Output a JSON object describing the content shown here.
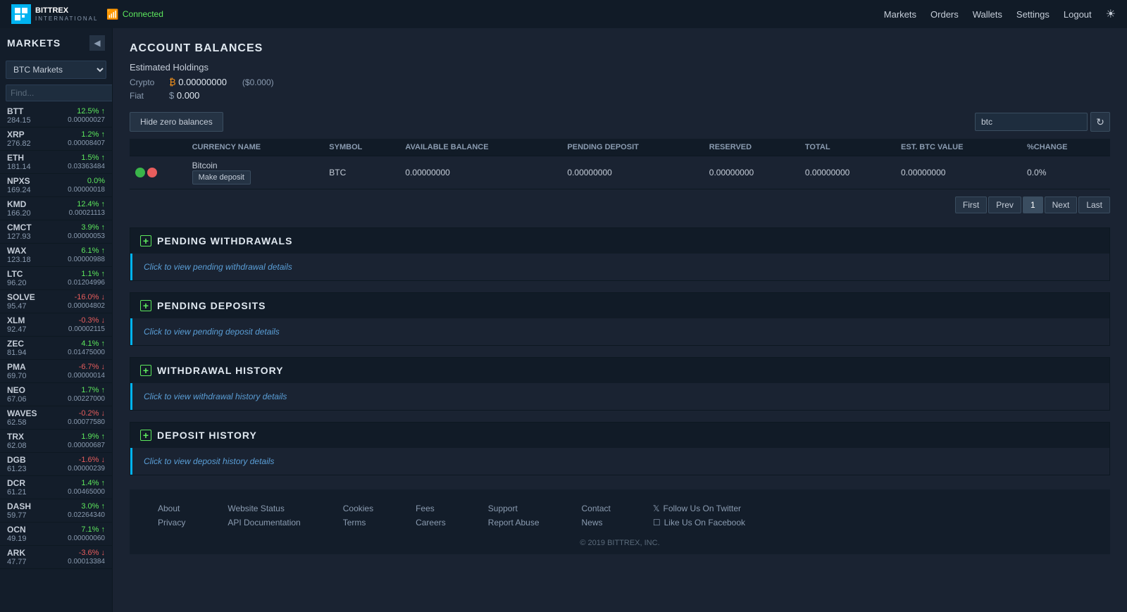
{
  "topNav": {
    "logoText": "BITTREX",
    "logoSub": "INTERNATIONAL",
    "connected": "Connected",
    "links": [
      "Markets",
      "Orders",
      "Wallets",
      "Settings",
      "Logout"
    ]
  },
  "sidebar": {
    "title": "MARKETS",
    "marketSelect": "BTC Markets",
    "searchPlaceholder": "Find...",
    "markets": [
      {
        "name": "BTT",
        "change": "12.5%",
        "dir": "up",
        "price": "284.15",
        "btc": "0.00000027"
      },
      {
        "name": "XRP",
        "change": "1.2%",
        "dir": "up",
        "price": "276.82",
        "btc": "0.00008407"
      },
      {
        "name": "ETH",
        "change": "1.5%",
        "dir": "up",
        "price": "181.14",
        "btc": "0.03363484"
      },
      {
        "name": "NPXS",
        "change": "0.0%",
        "dir": "neutral",
        "price": "169.24",
        "btc": "0.00000018"
      },
      {
        "name": "KMD",
        "change": "12.4%",
        "dir": "up",
        "price": "166.20",
        "btc": "0.00021113"
      },
      {
        "name": "CMCT",
        "change": "3.9%",
        "dir": "up",
        "price": "127.93",
        "btc": "0.00000053"
      },
      {
        "name": "WAX",
        "change": "6.1%",
        "dir": "up",
        "price": "123.18",
        "btc": "0.00000988"
      },
      {
        "name": "LTC",
        "change": "1.1%",
        "dir": "up",
        "price": "96.20",
        "btc": "0.01204996"
      },
      {
        "name": "SOLVE",
        "change": "-16.0%",
        "dir": "down",
        "price": "95.47",
        "btc": "0.00004802"
      },
      {
        "name": "XLM",
        "change": "-0.3%",
        "dir": "down",
        "price": "92.47",
        "btc": "0.00002115"
      },
      {
        "name": "ZEC",
        "change": "4.1%",
        "dir": "up",
        "price": "81.94",
        "btc": "0.01475000"
      },
      {
        "name": "PMA",
        "change": "-6.7%",
        "dir": "down",
        "price": "69.70",
        "btc": "0.00000014"
      },
      {
        "name": "NEO",
        "change": "1.7%",
        "dir": "up",
        "price": "67.06",
        "btc": "0.00227000"
      },
      {
        "name": "WAVES",
        "change": "-0.2%",
        "dir": "down",
        "price": "62.58",
        "btc": "0.00077580"
      },
      {
        "name": "TRX",
        "change": "1.9%",
        "dir": "up",
        "price": "62.08",
        "btc": "0.00000687"
      },
      {
        "name": "DGB",
        "change": "-1.6%",
        "dir": "down",
        "price": "61.23",
        "btc": "0.00000239"
      },
      {
        "name": "DCR",
        "change": "1.4%",
        "dir": "up",
        "price": "61.21",
        "btc": "0.00465000"
      },
      {
        "name": "DASH",
        "change": "3.0%",
        "dir": "up",
        "price": "59.77",
        "btc": "0.02264340"
      },
      {
        "name": "OCN",
        "change": "7.1%",
        "dir": "up",
        "price": "49.19",
        "btc": "0.00000060"
      },
      {
        "name": "ARK",
        "change": "-3.6%",
        "dir": "down",
        "price": "47.77",
        "btc": "0.00013384"
      }
    ]
  },
  "accountBalances": {
    "title": "ACCOUNT BALANCES",
    "estimatedHoldings": "Estimated Holdings",
    "cryptoLabel": "Crypto",
    "cryptoValue": "₿ 0.00000000",
    "cryptoUsd": "($0.000)",
    "fiatLabel": "Fiat",
    "fiatValue": "$ 0.000",
    "hideZeroBtn": "Hide zero balances",
    "searchValue": "btc",
    "tableHeaders": [
      "",
      "CURRENCY NAME",
      "SYMBOL",
      "AVAILABLE BALANCE",
      "PENDING DEPOSIT",
      "RESERVED",
      "TOTAL",
      "EST. BTC VALUE",
      "%CHANGE"
    ],
    "tableRows": [
      {
        "name": "Bitcoin",
        "symbol": "BTC",
        "available": "0.00000000",
        "pendingDeposit": "0.00000000",
        "reserved": "0.00000000",
        "total": "0.00000000",
        "estBtc": "0.00000000",
        "change": "0.0%"
      }
    ],
    "makeDepositBtn": "Make deposit",
    "pagination": {
      "first": "First",
      "prev": "Prev",
      "page": "1",
      "next": "Next",
      "last": "Last"
    }
  },
  "pendingWithdrawals": {
    "title": "PENDING WITHDRAWALS",
    "linkText": "Click to view pending withdrawal details"
  },
  "pendingDeposits": {
    "title": "PENDING DEPOSITS",
    "linkText": "Click to view pending deposit details"
  },
  "withdrawalHistory": {
    "title": "WITHDRAWAL HISTORY",
    "linkText": "Click to view withdrawal history details"
  },
  "depositHistory": {
    "title": "DEPOSIT HISTORY",
    "linkText": "Click to view deposit history details"
  },
  "footer": {
    "links": [
      {
        "label": "About",
        "url": "#"
      },
      {
        "label": "Privacy",
        "url": "#"
      },
      {
        "label": "Website Status",
        "url": "#"
      },
      {
        "label": "API Documentation",
        "url": "#"
      },
      {
        "label": "Cookies",
        "url": "#"
      },
      {
        "label": "Terms",
        "url": "#"
      },
      {
        "label": "Fees",
        "url": "#"
      },
      {
        "label": "Careers",
        "url": "#"
      },
      {
        "label": "Support",
        "url": "#"
      },
      {
        "label": "Report Abuse",
        "url": "#"
      },
      {
        "label": "Contact",
        "url": "#"
      },
      {
        "label": "News",
        "url": "#"
      },
      {
        "label": "Follow Us On Twitter",
        "url": "#"
      },
      {
        "label": "Like Us On Facebook",
        "url": "#"
      }
    ],
    "copyright": "© 2019 BITTREX, INC."
  }
}
